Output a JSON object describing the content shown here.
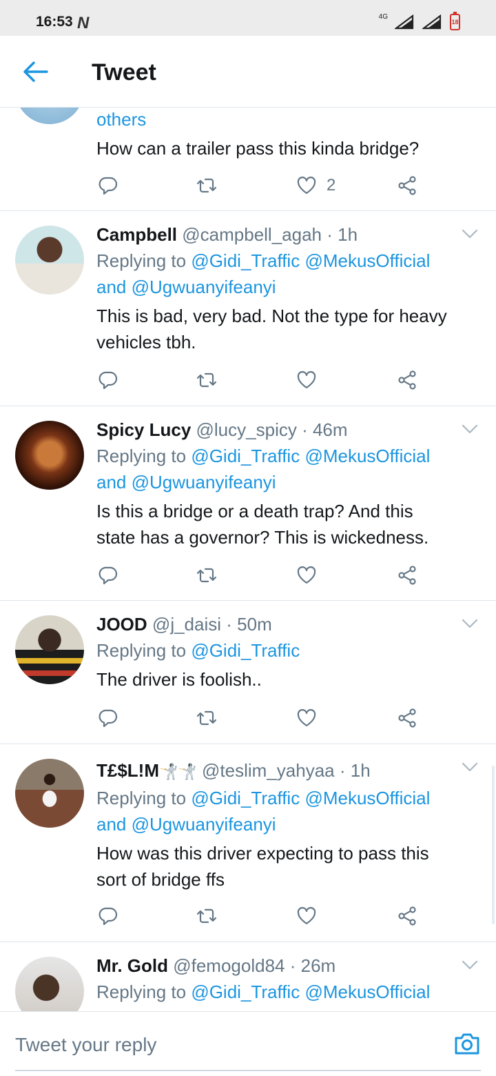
{
  "status_bar": {
    "time": "16:53",
    "network": "4G",
    "battery": "18"
  },
  "header": {
    "title": "Tweet"
  },
  "top_tweet": {
    "mentions_tail": "others",
    "text": "How can a trailer pass this kinda bridge?",
    "likes": "2"
  },
  "replies": [
    {
      "name": "Campbell",
      "handle": "@campbell_agah",
      "time": "· 1h",
      "replying_label": "Replying to",
      "mentions": [
        "@Gidi_Traffic",
        "@MekusOfficial"
      ],
      "and_label": "and",
      "mention_last": "@Ugwuanyifeanyi",
      "text_lines": [
        "This is bad, very bad. Not the type for heavy",
        "vehicles tbh."
      ]
    },
    {
      "name": "Spicy Lucy",
      "handle": "@lucy_spicy",
      "time": "· 46m",
      "replying_label": "Replying to",
      "mentions": [
        "@Gidi_Traffic",
        "@MekusOfficial"
      ],
      "and_label": "and",
      "mention_last": "@Ugwuanyifeanyi",
      "text_lines": [
        "Is this a bridge or a death trap? And this",
        "state has a governor? This is wickedness."
      ]
    },
    {
      "name": "JOOD",
      "handle": "@j_daisi",
      "time": "· 50m",
      "replying_label": "Replying to",
      "mentions": [
        "@Gidi_Traffic"
      ],
      "text_lines": [
        "The driver is foolish.."
      ]
    },
    {
      "name": "T£$L!M",
      "name_emoji": "🤺🤺",
      "handle": "@teslim_yahyaa",
      "time": "· 1h",
      "replying_label": "Replying to",
      "mentions": [
        "@Gidi_Traffic",
        "@MekusOfficial"
      ],
      "and_label": "and",
      "mention_last": "@Ugwuanyifeanyi",
      "text_lines": [
        "How was this driver expecting to pass this",
        "sort of bridge ffs"
      ]
    },
    {
      "name": "Mr. Gold",
      "handle": "@femogold84",
      "time": "· 26m",
      "replying_label": "Replying to",
      "mentions": [
        "@Gidi_Traffic",
        "@MekusOfficial"
      ]
    }
  ],
  "reply_bar": {
    "placeholder": "Tweet your reply"
  },
  "colors": {
    "accent": "#1b95e0",
    "muted": "#657786",
    "divider": "#dfe5ea"
  },
  "icons": [
    "back-arrow-icon",
    "reply-icon",
    "retweet-icon",
    "like-icon",
    "share-icon",
    "chevron-down-icon",
    "camera-icon"
  ]
}
